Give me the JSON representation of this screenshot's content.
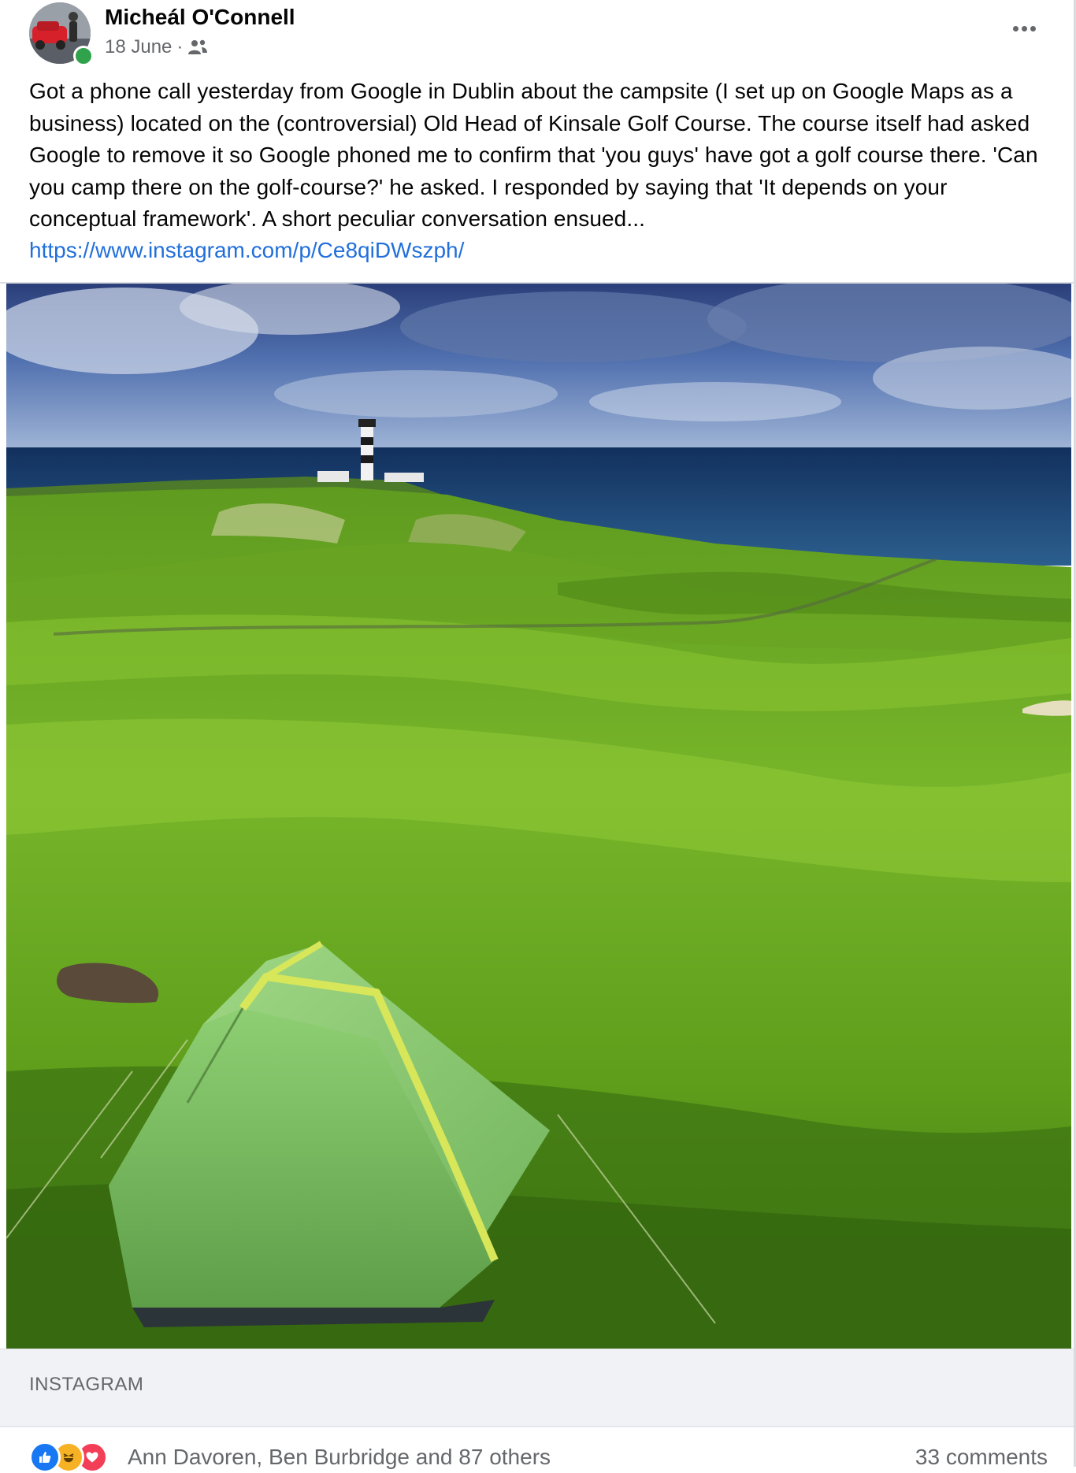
{
  "post": {
    "author": "Micheál O'Connell",
    "date": "18 June",
    "separator": "·",
    "audience_icon": "friends-icon",
    "text": "Got a phone call yesterday from Google in Dublin about the campsite (I set up on Google Maps as a business) located on the (controversial) Old Head of Kinsale Golf Course. The course itself had asked Google to remove it so Google phoned me to confirm that 'you guys' have got a golf course there. 'Can you camp there on the golf-course?' he asked. I responded by saying that 'It depends on your conceptual framework'. A short peculiar conversation ensued...",
    "link": "https://www.instagram.com/p/Ce8qiDWszph/",
    "link_source": "INSTAGRAM"
  },
  "reactions": {
    "icons": [
      "like-icon",
      "haha-icon",
      "love-icon"
    ],
    "names": "Ann Davoren, Ben Burbridge and 87 others",
    "comments": "33 comments"
  },
  "colors": {
    "link": "#216fdb",
    "online": "#31a24c",
    "like": "#1877f2",
    "haha": "#f7b125",
    "love": "#f33e58"
  }
}
